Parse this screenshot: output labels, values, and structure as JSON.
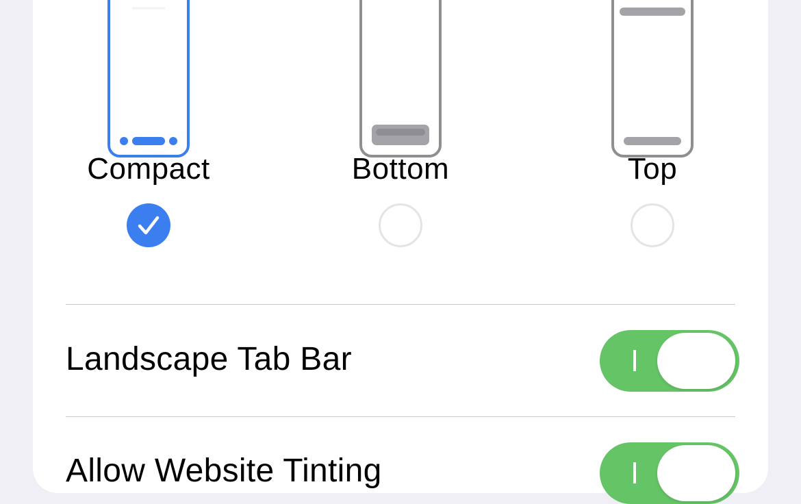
{
  "tab_layout": {
    "options": [
      {
        "label": "Compact",
        "selected": true,
        "icon": "compact-layout-icon"
      },
      {
        "label": "Bottom",
        "selected": false,
        "icon": "bottom-layout-icon"
      },
      {
        "label": "Top",
        "selected": false,
        "icon": "top-layout-icon"
      }
    ]
  },
  "settings": {
    "landscape_tab_bar": {
      "label": "Landscape Tab Bar",
      "enabled": true
    },
    "allow_website_tinting": {
      "label": "Allow Website Tinting",
      "enabled": true
    }
  },
  "colors": {
    "accent": "#3b7ef0",
    "toggle_on": "#65c466",
    "unselected_icon": "#8e8e93",
    "background": "#f0eff5"
  }
}
